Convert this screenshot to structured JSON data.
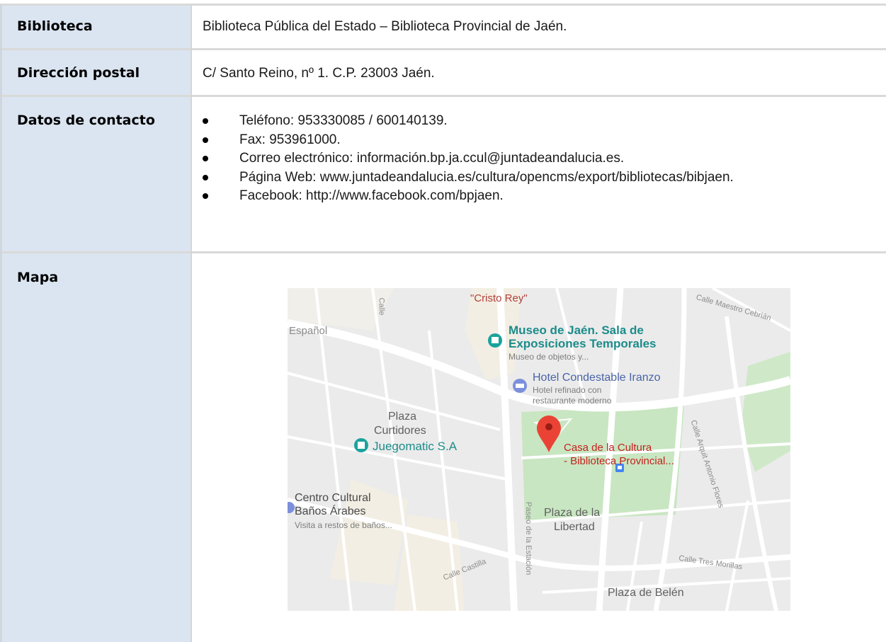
{
  "rows": {
    "biblioteca": {
      "label": "Biblioteca",
      "value": "Biblioteca Pública del Estado – Biblioteca Provincial de Jaén."
    },
    "direccion": {
      "label": "Dirección postal",
      "value": "C/ Santo Reino, nº 1. C.P. 23003 Jaén."
    },
    "contacto": {
      "label": "Datos de contacto",
      "items": [
        "Teléfono: 953330085 / 600140139.",
        "Fax: 953961000.",
        "Correo electrónico: información.bp.ja.ccul@juntadeandalucia.es.",
        "Página Web: www.juntadeandalucia.es/cultura/opencms/export/bibliotecas/bibjaen.",
        "Facebook: http://www.facebook.com/bpjaen."
      ]
    },
    "mapa": {
      "label": "Mapa",
      "map": {
        "labels": {
          "cristo_rey": "\"Cristo Rey\"",
          "espanol": "Español",
          "maestro_cebrian": "Calle Maestro Cebrián",
          "museo_title_1": "Museo de Jaén. Sala de",
          "museo_title_2": "Exposiciones Temporales",
          "museo_sub": "Museo de objetos y...",
          "hotel_title": "Hotel Condestable Iranzo",
          "hotel_sub_1": "Hotel refinado con",
          "hotel_sub_2": "restaurante moderno",
          "plaza_curtidores_1": "Plaza",
          "plaza_curtidores_2": "Curtidores",
          "juegomatic": "Juegomatic S.A",
          "casa_cultura_1": "Casa de la Cultura",
          "casa_cultura_2": "- Biblioteca Provincial...",
          "arquit_flores": "Calle Arquit Antonio Flores",
          "centro_cultural_1": "Centro Cultural",
          "centro_cultural_2": "Baños Árabes",
          "centro_cultural_sub": "Visita a restos de baños...",
          "plaza_libertad_1": "Plaza de la",
          "plaza_libertad_2": "Libertad",
          "paseo_estacion": "Paseo de la Estación",
          "calle_castilla": "Calle Castilla",
          "tres_morillas": "Calle Tres Morillas",
          "plaza_belen": "Plaza de Belén",
          "calle_vertical": "Calle"
        }
      }
    }
  },
  "colors": {
    "label_bg": "#dbe5f1",
    "row_border": "#d9d9d9",
    "map_marker": "#ea4335",
    "park": "#c8e6c1"
  }
}
